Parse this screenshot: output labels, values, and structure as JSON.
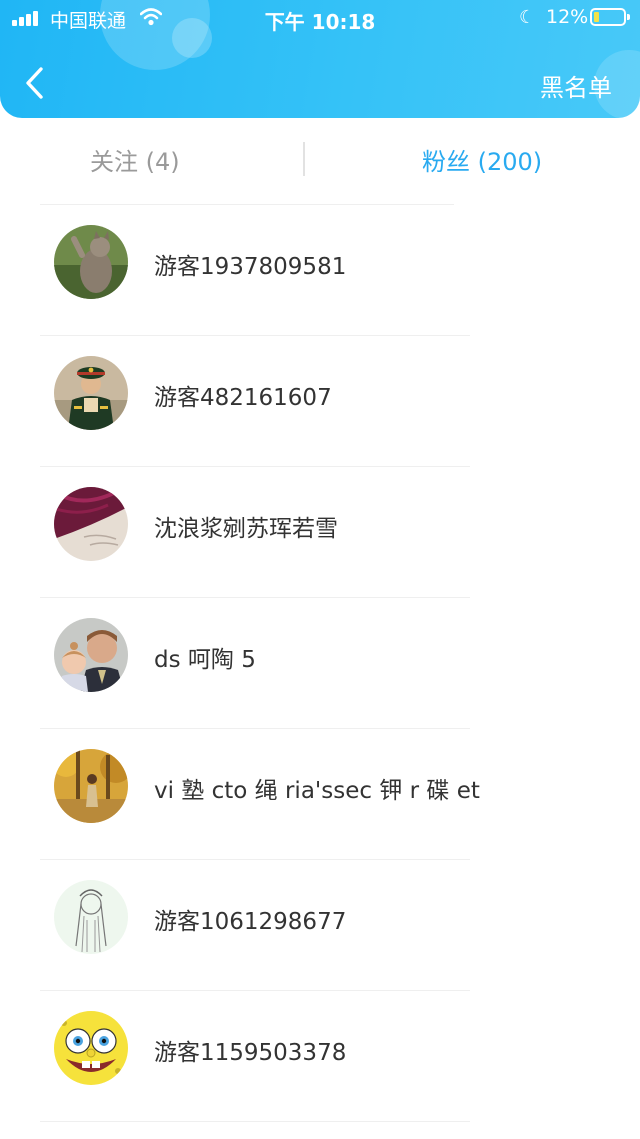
{
  "status_bar": {
    "carrier": "中国联通",
    "time": "下午 10:18",
    "battery_percent": "12%",
    "battery_level": 0.12,
    "icons": [
      "signal-icon",
      "wifi-icon",
      "moon-icon",
      "battery-icon"
    ]
  },
  "nav": {
    "back_icon": "chevron-left-icon",
    "right_action": "黑名单"
  },
  "tabs": {
    "follow": "关注 (4)",
    "fans": "粉丝 (200)",
    "active": "fans"
  },
  "colors": {
    "header": "#2ab8f5",
    "active_tab": "#29aaf0",
    "inactive_tab": "#9a9a9a"
  },
  "users": [
    {
      "name": "游客1937809581",
      "avatar": "cat-photo-avatar"
    },
    {
      "name": "游客482161607",
      "avatar": "soldier-photo-avatar"
    },
    {
      "name": "沈浪浆剜苏珲若雪",
      "avatar": "flower-photo-avatar"
    },
    {
      "name": "ds 呵陶 5",
      "avatar": "family-photo-avatar"
    },
    {
      "name": "vi 塾 cto 绳 ria'ssec 钾 r 碟 et",
      "avatar": "autumn-photo-avatar"
    },
    {
      "name": "游客1061298677",
      "avatar": "sketch-girl-avatar"
    },
    {
      "name": "游客1159503378",
      "avatar": "spongebob-avatar"
    }
  ]
}
